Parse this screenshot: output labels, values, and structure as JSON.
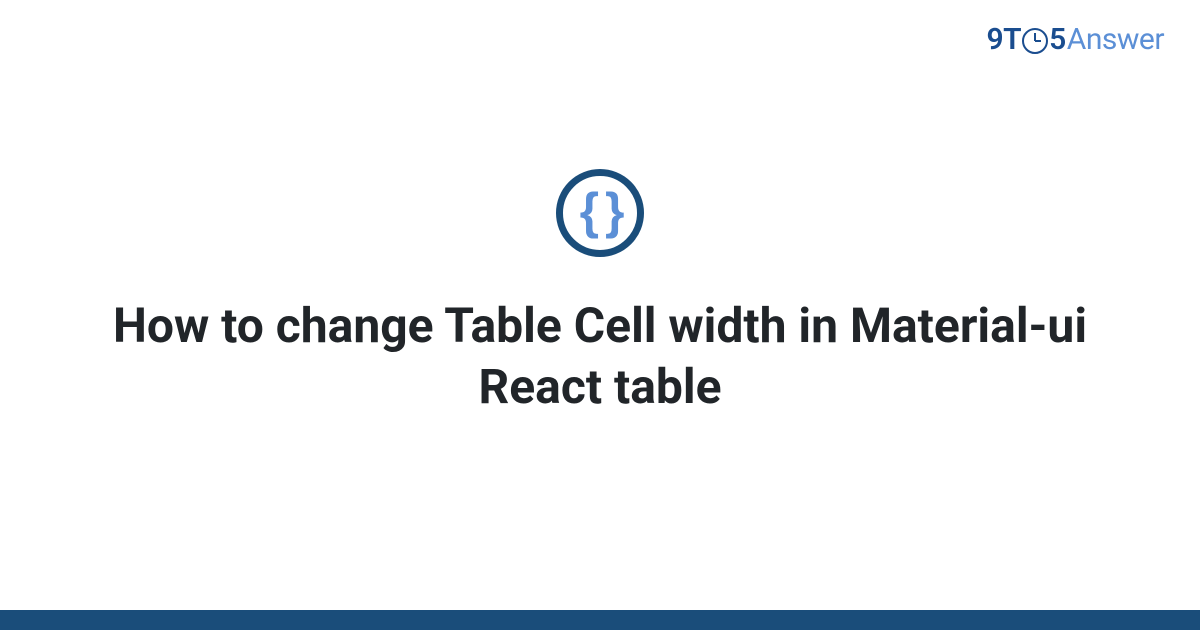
{
  "brand": {
    "prefix": "9T",
    "middle": "5",
    "suffix": "Answer"
  },
  "category": {
    "icon_name": "code-braces-icon",
    "glyph": "{ }"
  },
  "title": "How to change Table Cell width in Material-ui React table",
  "colors": {
    "brand_dark": "#1a4d8f",
    "brand_light": "#5b8fd6",
    "footer": "#1a4d7a",
    "text": "#212529"
  }
}
